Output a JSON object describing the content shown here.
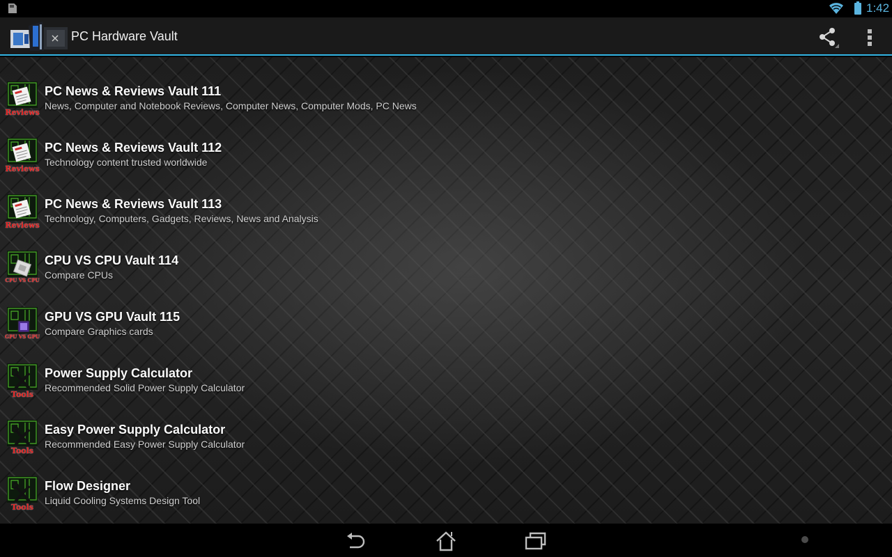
{
  "status_bar": {
    "time": "1:42",
    "icons": [
      "sd-card-icon",
      "wifi-icon",
      "battery-icon"
    ],
    "accent_color": "#5ab4df"
  },
  "action_bar": {
    "title": "PC Hardware Vault",
    "logo": "pc-cases-logo",
    "actions": [
      {
        "name": "share",
        "icon": "share-icon"
      },
      {
        "name": "overflow",
        "icon": "overflow-menu-icon"
      }
    ],
    "divider_color": "#33b5e5"
  },
  "list": {
    "items": [
      {
        "title": "PC News & Reviews Vault 111",
        "subtitle": "News, Computer and Notebook Reviews, Computer News, Computer Mods, PC News",
        "icon": "reviews-icon",
        "icon_label": "Reviews"
      },
      {
        "title": "PC News & Reviews Vault 112",
        "subtitle": "Technology content trusted worldwide",
        "icon": "reviews-icon",
        "icon_label": "Reviews"
      },
      {
        "title": "PC News & Reviews Vault 113",
        "subtitle": "Technology, Computers, Gadgets, Reviews, News and Analysis",
        "icon": "reviews-icon",
        "icon_label": "Reviews"
      },
      {
        "title": "CPU VS CPU Vault 114",
        "subtitle": "Compare CPUs",
        "icon": "cpu-vs-cpu-icon",
        "icon_label": "CPU VS CPU"
      },
      {
        "title": "GPU VS GPU Vault 115",
        "subtitle": "Compare Graphics cards",
        "icon": "gpu-vs-gpu-icon",
        "icon_label": "GPU VS GPU"
      },
      {
        "title": "Power Supply Calculator",
        "subtitle": "Recommended Solid Power Supply Calculator",
        "icon": "tools-icon",
        "icon_label": "Tools"
      },
      {
        "title": "Easy Power Supply Calculator",
        "subtitle": "Recommended Easy Power Supply Calculator",
        "icon": "tools-icon",
        "icon_label": "Tools"
      },
      {
        "title": "Flow Designer",
        "subtitle": "Liquid Cooling Systems Design Tool",
        "icon": "tools-icon",
        "icon_label": "Tools"
      }
    ]
  },
  "nav_bar": {
    "buttons": [
      {
        "name": "back",
        "icon": "back-icon"
      },
      {
        "name": "home",
        "icon": "home-icon"
      },
      {
        "name": "recents",
        "icon": "recent-apps-icon"
      }
    ]
  }
}
